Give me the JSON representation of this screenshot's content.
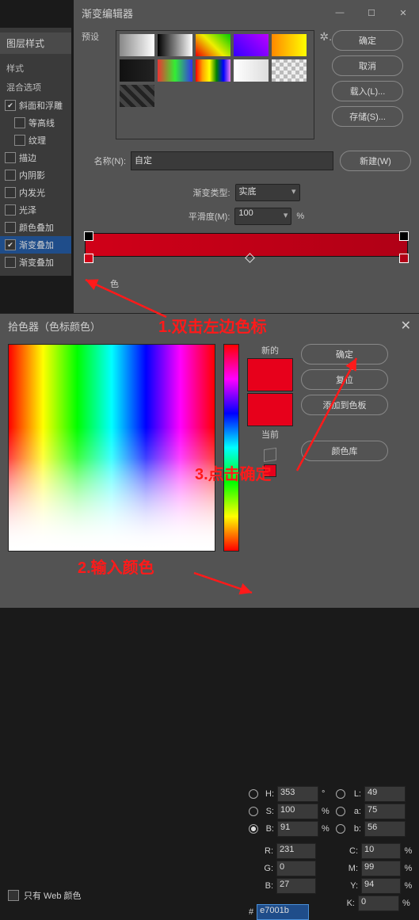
{
  "topbar": {
    "dash": "—",
    "square": "☐",
    "x": "✕"
  },
  "layerStyle": {
    "tab": "图层样式",
    "style": "样式",
    "blend": "混合选项",
    "items": [
      {
        "label": "斜面和浮雕",
        "chk": true,
        "sub": false
      },
      {
        "label": "等高线",
        "chk": false,
        "sub": true
      },
      {
        "label": "纹理",
        "chk": false,
        "sub": true
      },
      {
        "label": "描边",
        "chk": false,
        "sub": false
      },
      {
        "label": "内阴影",
        "chk": false,
        "sub": false
      },
      {
        "label": "内发光",
        "chk": false,
        "sub": false
      },
      {
        "label": "光泽",
        "chk": false,
        "sub": false
      },
      {
        "label": "颜色叠加",
        "chk": false,
        "sub": false
      },
      {
        "label": "渐变叠加",
        "chk": true,
        "sub": false,
        "sel": true
      },
      {
        "label": "渐变叠加",
        "chk": false,
        "sub": false
      }
    ]
  },
  "gradEditor": {
    "title": "渐变编辑器",
    "presetsLabel": "预设",
    "buttons": {
      "ok": "确定",
      "cancel": "取消",
      "load": "载入(L)...",
      "save": "存储(S)...",
      "new": "新建(W)"
    },
    "nameLabel": "名称(N):",
    "nameValue": "自定",
    "typeLabel": "渐变类型:",
    "typeValue": "实底",
    "smoothLabel": "平滑度(M):",
    "smoothValue": "100",
    "smoothUnit": "%",
    "colorLabel": "色"
  },
  "annotations": {
    "a1": "1.双击左边色标",
    "a2": "2.输入颜色",
    "a3": "3.点击确定"
  },
  "picker": {
    "title": "拾色器（色标颜色）",
    "buttons": {
      "ok": "确定",
      "reset": "复位",
      "add": "添加到色板",
      "lib": "颜色库"
    },
    "newLabel": "新的",
    "curLabel": "当前",
    "webOnly": "只有 Web 颜色",
    "H": {
      "lab": "H:",
      "val": "353",
      "unit": "°"
    },
    "S": {
      "lab": "S:",
      "val": "100",
      "unit": "%"
    },
    "Bv": {
      "lab": "B:",
      "val": "91",
      "unit": "%"
    },
    "R": {
      "lab": "R:",
      "val": "231"
    },
    "G": {
      "lab": "G:",
      "val": "0"
    },
    "B2": {
      "lab": "B:",
      "val": "27"
    },
    "L": {
      "lab": "L:",
      "val": "49"
    },
    "a": {
      "lab": "a:",
      "val": "75"
    },
    "b": {
      "lab": "b:",
      "val": "56"
    },
    "C": {
      "lab": "C:",
      "val": "10",
      "unit": "%"
    },
    "M": {
      "lab": "M:",
      "val": "99",
      "unit": "%"
    },
    "Y": {
      "lab": "Y:",
      "val": "94",
      "unit": "%"
    },
    "K": {
      "lab": "K:",
      "val": "0",
      "unit": "%"
    },
    "hash": "#",
    "hex": "e7001b"
  }
}
